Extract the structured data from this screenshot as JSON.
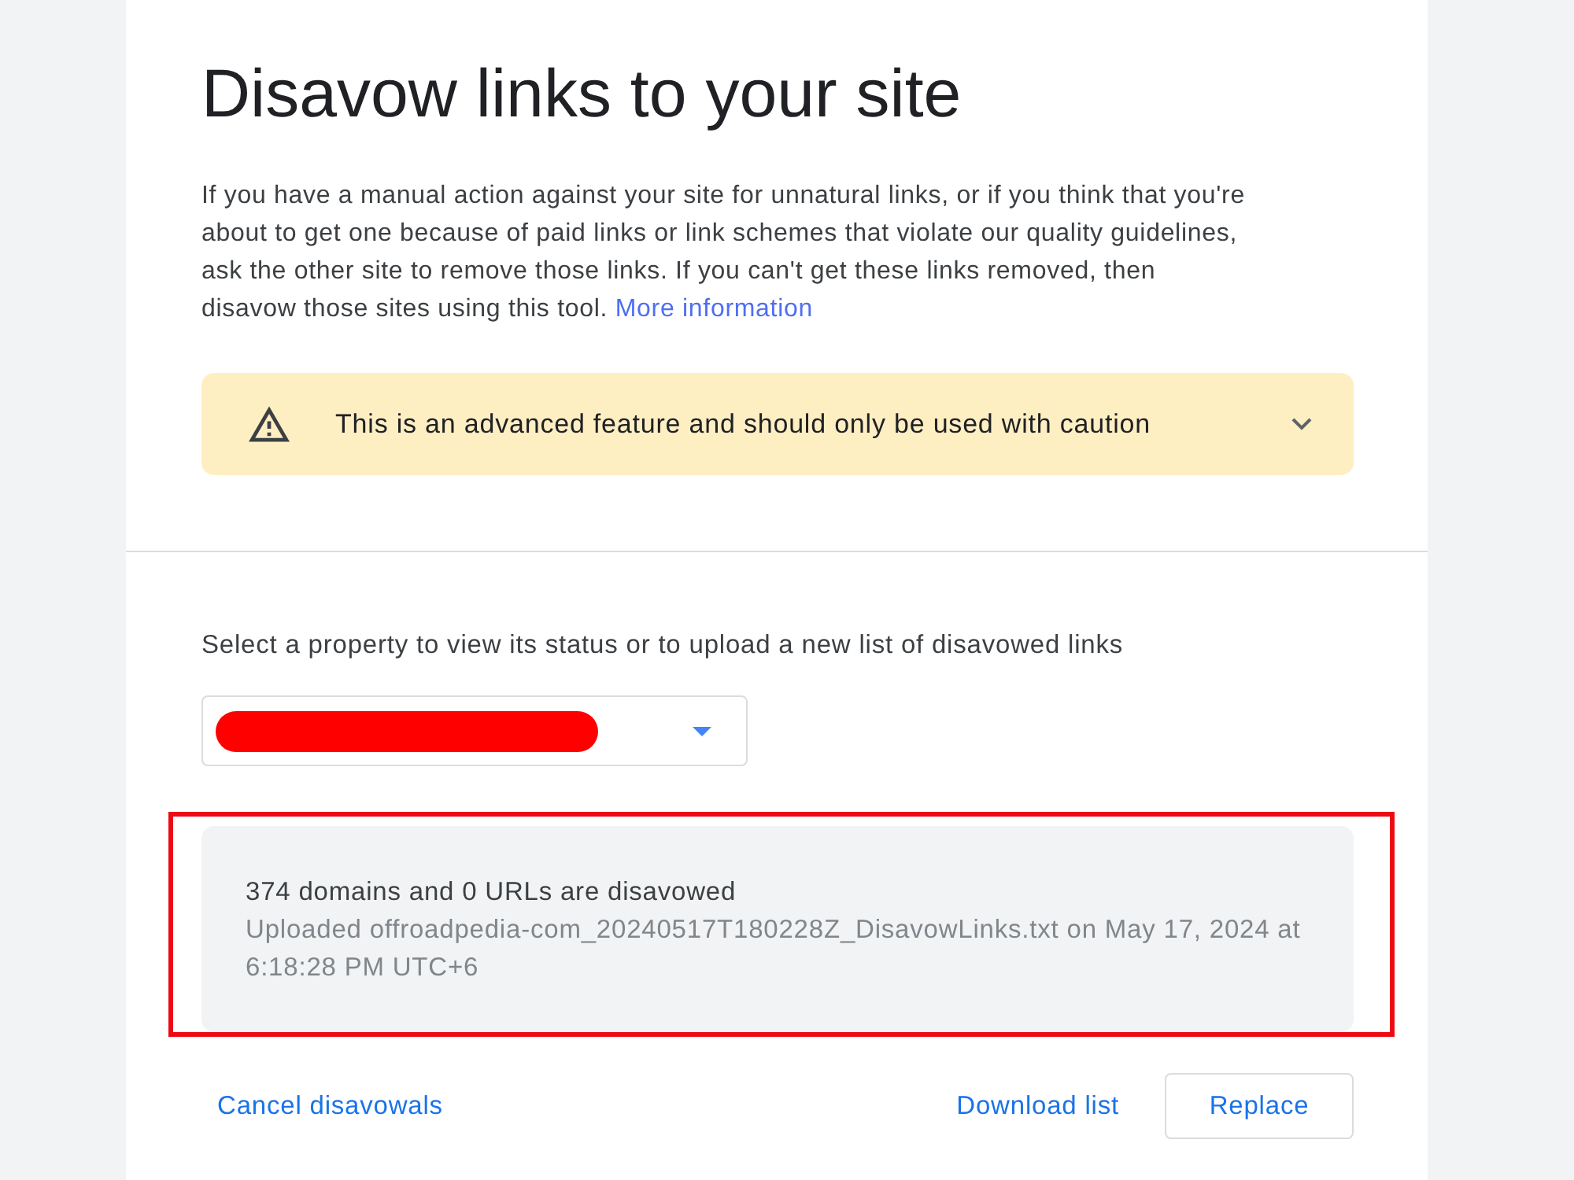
{
  "page": {
    "title": "Disavow links to your site",
    "description": "If you have a manual action against your site for unnatural links, or if you think that you're about to get one because of paid links or link schemes that violate our quality guidelines, ask the other site to remove those links. If you can't get these links removed, then disavow those sites using this tool.",
    "more_link": "More information"
  },
  "warning": {
    "text": "This is an advanced feature and should only be used with caution",
    "expanded": false
  },
  "property_selector": {
    "label": "Select a property to view its status or to upload a new list of disavowed links",
    "value_redacted": true
  },
  "status": {
    "summary": "374 domains and 0 URLs are disavowed",
    "details": "Uploaded offroadpedia-com_20240517T180228Z_DisavowLinks.txt on May 17, 2024 at 6:18:28 PM UTC+6",
    "highlighted": true
  },
  "actions_left": [
    {
      "label": "Cancel disavowals",
      "kind": "link"
    }
  ],
  "actions_right": [
    {
      "label": "Download list",
      "kind": "link"
    },
    {
      "label": "Replace",
      "kind": "outlined"
    }
  ]
}
